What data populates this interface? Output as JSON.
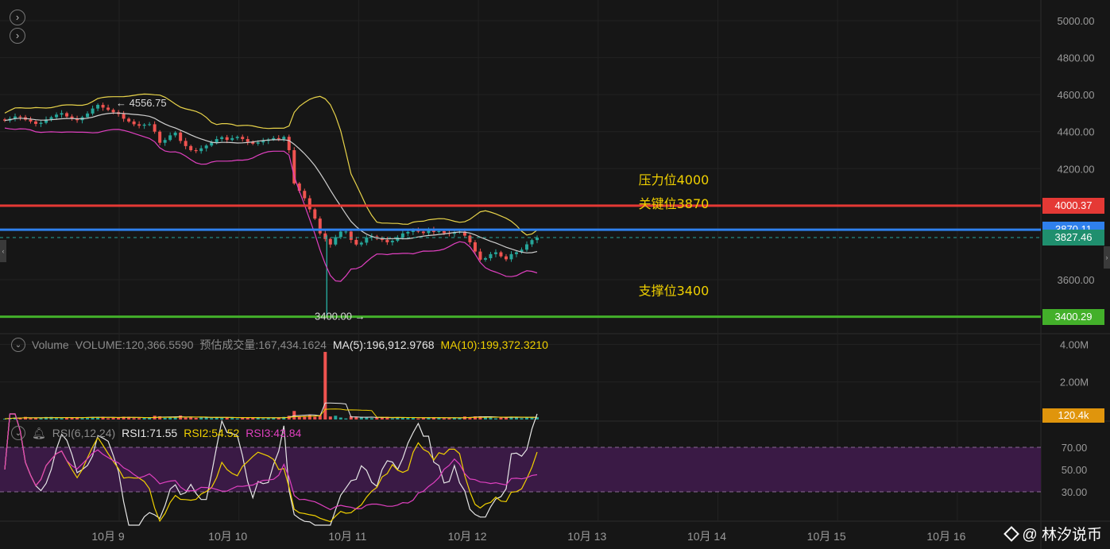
{
  "toolbar": {
    "expand_label": "›",
    "collapse_label": "›"
  },
  "colors": {
    "up": "#26a69a",
    "down": "#ef5350",
    "resistance": "#e53935",
    "key": "#2f80ed",
    "support": "#43b02a",
    "bb_upper": "#e8d34a",
    "bb_mid": "#cfcfcf",
    "bb_lower": "#e040c0",
    "rsi_band": "#3a1a45"
  },
  "chart_data": [
    {
      "type": "candlestick",
      "title": "",
      "ylim": [
        3360,
        5060
      ],
      "yticks": [
        5000,
        4800,
        4600,
        4400,
        4200,
        3600
      ],
      "ytick_labels": [
        "5000.00",
        "4800.00",
        "4600.00",
        "4400.00",
        "4200.00",
        "3600.00"
      ],
      "xticks": [
        "10月 9",
        "10月 10",
        "10月 11",
        "10月 12",
        "10月 13",
        "10月 14",
        "10月 15",
        "10月 16"
      ],
      "xlim_days": [
        8.2,
        17.1
      ],
      "annotations": [
        {
          "text": "压力位4000",
          "price": 4000,
          "line_value": "4000.37",
          "color": "#e53935"
        },
        {
          "text": "关键位3870",
          "price": 3870,
          "line_value": "3870.11",
          "color": "#2f80ed"
        },
        {
          "text": "支撑位3400",
          "price": 3400,
          "line_value": "3400.29",
          "color": "#43b02a"
        }
      ],
      "current_price": "3827.46",
      "current_price_value": 3827.46,
      "high_label": "← 4556.75",
      "high_value": 4556.75,
      "low_label": "3400.00 →",
      "low_value": 3400.0,
      "close_series": [
        4460,
        4470,
        4482,
        4478,
        4465,
        4455,
        4442,
        4448,
        4466,
        4478,
        4492,
        4500,
        4482,
        4470,
        4462,
        4478,
        4498,
        4525,
        4545,
        4530,
        4518,
        4505,
        4495,
        4470,
        4455,
        4440,
        4432,
        4438,
        4440,
        4400,
        4340,
        4355,
        4380,
        4395,
        4350,
        4322,
        4300,
        4295,
        4310,
        4325,
        4342,
        4360,
        4370,
        4355,
        4365,
        4372,
        4360,
        4345,
        4335,
        4342,
        4350,
        4358,
        4365,
        4360,
        4372,
        4300,
        4120,
        4080,
        4040,
        3980,
        3930,
        3850,
        3820,
        3790,
        3830,
        3860,
        3860,
        3815,
        3790,
        3800,
        3828,
        3834,
        3822,
        3815,
        3802,
        3810,
        3828,
        3850,
        3858,
        3866,
        3860,
        3852,
        3870,
        3858,
        3862,
        3852,
        3848,
        3856,
        3860,
        3838,
        3802,
        3752,
        3708,
        3716,
        3738,
        3748,
        3726,
        3710,
        3738,
        3748,
        3762,
        3791,
        3814,
        3827
      ],
      "volume": {
        "ylim": [
          0,
          4400000
        ],
        "yticks": [
          4000000,
          2000000
        ],
        "ytick_labels": [
          "4.00M",
          "2.00M"
        ],
        "current_label": "120.4k",
        "legend": {
          "name": "Volume",
          "volume": "VOLUME:120,366.5590",
          "estimate": "预估成交量:167,434.1624",
          "ma5": "MA(5):196,912.9768",
          "ma10": "MA(10):199,372.3210"
        },
        "spike_value": 3600000
      },
      "rsi": {
        "ylim": [
          0,
          100
        ],
        "yticks": [
          70,
          50,
          30
        ],
        "ytick_labels": [
          "70.00",
          "50.00",
          "30.00"
        ],
        "legend": {
          "name": "RSI(6,12,24)",
          "rsi1": "RSI1:71.55",
          "rsi2": "RSI2:54.52",
          "rsi3": "RSI3:43.84"
        }
      }
    }
  ],
  "watermark": "@ 林汐说币"
}
